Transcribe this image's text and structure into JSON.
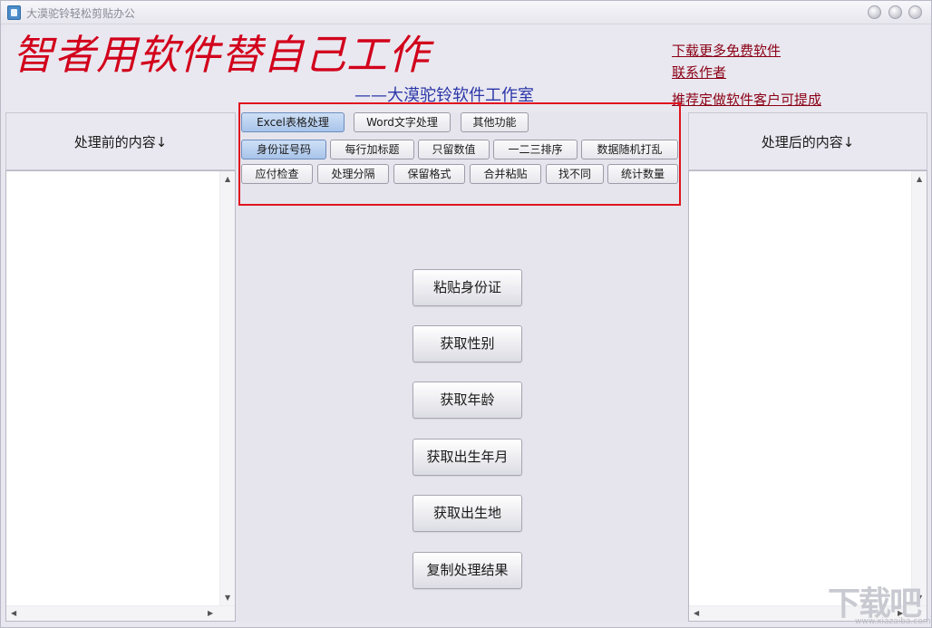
{
  "window": {
    "title": "大漠驼铃轻松剪贴办公"
  },
  "header": {
    "slogan": "智者用软件替自己工作",
    "studio": "——大漠驼铃软件工作室",
    "links": [
      "下载更多免费软件",
      "联系作者",
      "推荐定做软件客户可提成"
    ]
  },
  "panels": {
    "left_title": "处理前的内容↓",
    "right_title": "处理后的内容↓"
  },
  "tabs": [
    "Excel表格处理",
    "Word文字处理",
    "其他功能"
  ],
  "function_row1": [
    "身份证号码",
    "每行加标题",
    "只留数值",
    "一二三排序",
    "数据随机打乱"
  ],
  "function_row2": [
    "应付检查",
    "处理分隔",
    "保留格式",
    "合并粘贴",
    "找不同",
    "统计数量"
  ],
  "actions": [
    "粘贴身份证",
    "获取性别",
    "获取年龄",
    "获取出生年月",
    "获取出生地",
    "复制处理结果"
  ],
  "watermark": {
    "text": "下载吧",
    "url": "www.xiazaiba.com"
  },
  "colors": {
    "slogan": "#d2001b",
    "studio": "#2b36a8",
    "link": "#8b0015",
    "highlight": "#e0141f",
    "active_button": "#a8c4ea"
  }
}
